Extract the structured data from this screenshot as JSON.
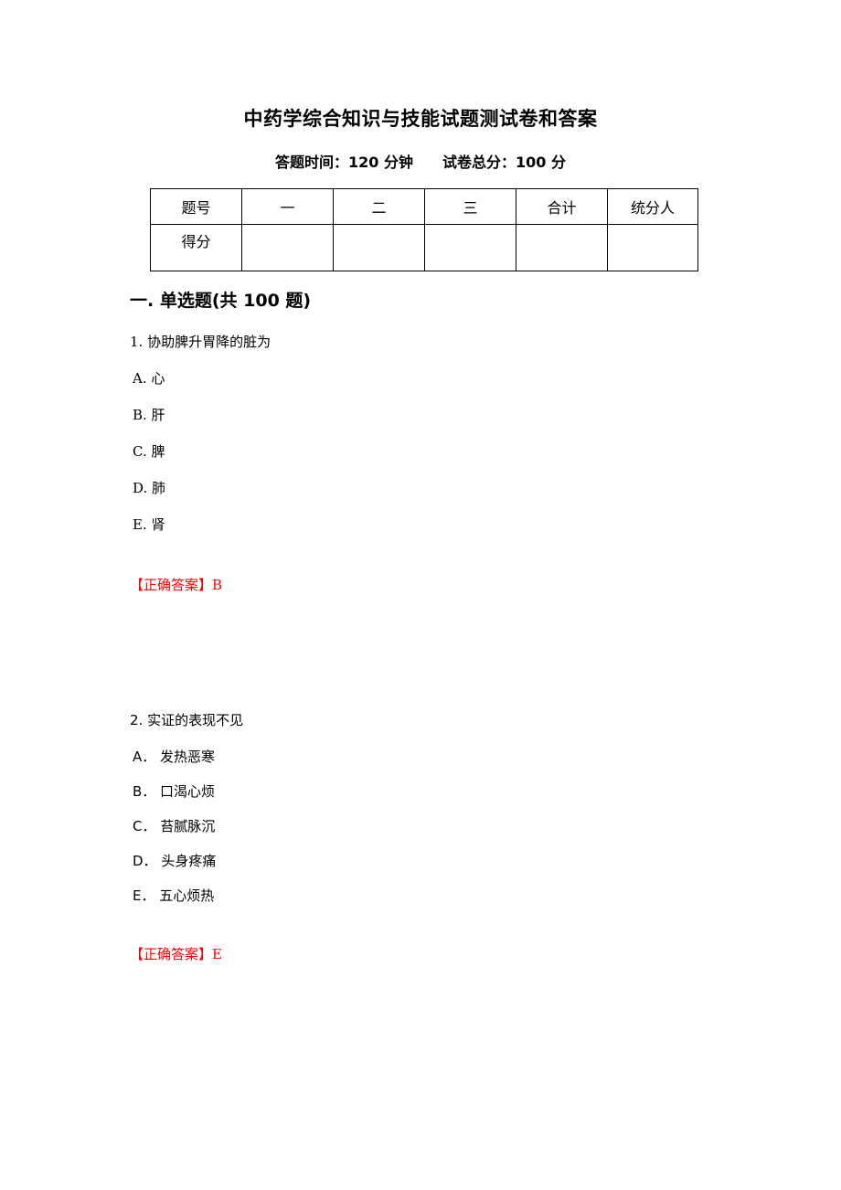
{
  "document": {
    "title": "中药学综合知识与技能试题测试卷和答案",
    "subtitle": "答题时间：120 分钟　　试卷总分：100 分"
  },
  "score_table": {
    "headers": [
      "题号",
      "一",
      "二",
      "三",
      "合计",
      "统分人"
    ],
    "score_row_label": "得分",
    "score_row_values": [
      "",
      "",
      "",
      "",
      ""
    ]
  },
  "section": {
    "heading": "一. 单选题(共 100 题)"
  },
  "questions": [
    {
      "stem": "1. 协助脾升胃降的脏为",
      "options": [
        "A. 心",
        "B. 肝",
        "C. 脾",
        "D. 肺",
        "E. 肾"
      ],
      "answer": "【正确答案】B"
    },
    {
      "stem": "2. 实证的表现不见",
      "options": [
        "A． 发热恶寒",
        "B． 口渴心烦",
        "C． 苔腻脉沉",
        "D． 头身疼痛",
        "E． 五心烦热"
      ],
      "answer": "【正确答案】E"
    }
  ],
  "colors": {
    "answer_red": "#ff0000",
    "text_black": "#000000",
    "table_outer_border": "#9a9a9a",
    "table_inner_border": "#000000",
    "page_background": "#ffffff"
  }
}
